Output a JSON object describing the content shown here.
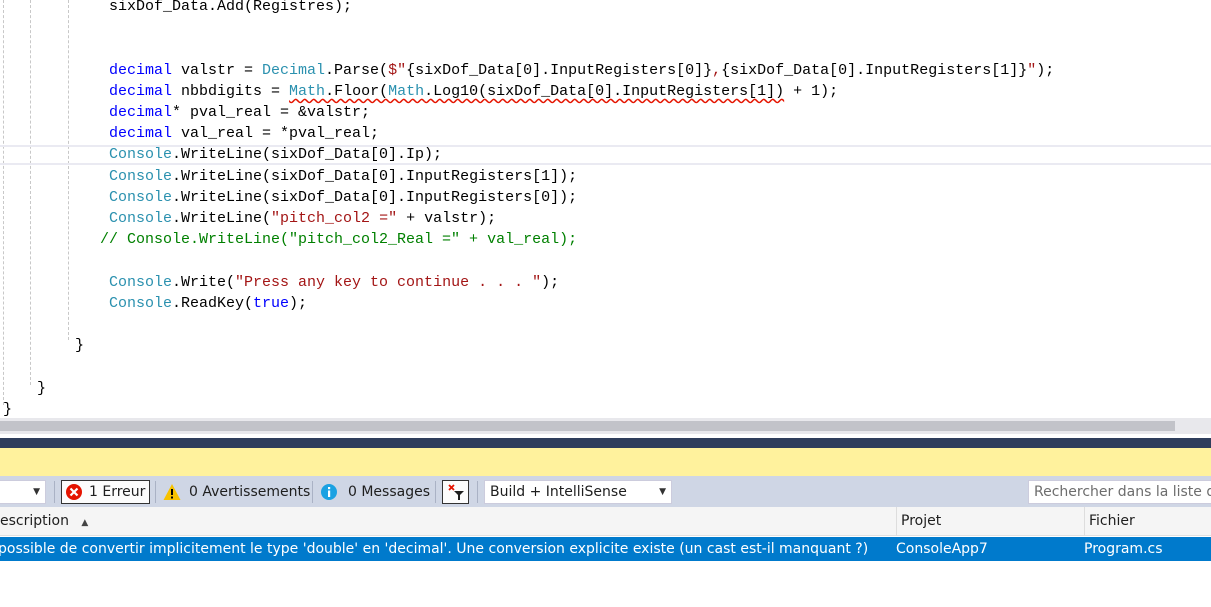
{
  "editor": {
    "lines": [
      {
        "indent": 109,
        "tokens": [
          [
            "sixDof_Data.Add(Registres);",
            ""
          ]
        ]
      },
      {
        "indent": 0,
        "tokens": []
      },
      {
        "indent": 0,
        "tokens": []
      },
      {
        "indent": 109,
        "tokens": [
          [
            "decimal",
            "kw"
          ],
          [
            " valstr = ",
            ""
          ],
          [
            "Decimal",
            "type"
          ],
          [
            ".Parse(",
            ""
          ],
          [
            "$\"",
            "str"
          ],
          [
            "{sixDof_Data[0].InputRegisters[0]}",
            ""
          ],
          [
            ",",
            "str"
          ],
          [
            "{sixDof_Data[0].InputRegisters[1]}",
            ""
          ],
          [
            "\"",
            "str"
          ],
          [
            ");",
            ""
          ]
        ]
      },
      {
        "indent": 109,
        "tokens": [
          [
            "decimal",
            "kw"
          ],
          [
            " nbbdigits = ",
            ""
          ],
          [
            "Math",
            "type err"
          ],
          [
            ".Floor(",
            "err"
          ],
          [
            "Math",
            "type err"
          ],
          [
            ".Log10(sixDof_Data[0].InputRegisters[1])",
            "err"
          ],
          [
            " + 1);",
            ""
          ]
        ]
      },
      {
        "indent": 109,
        "tokens": [
          [
            "decimal",
            "kw"
          ],
          [
            "* pval_real = &valstr;",
            ""
          ]
        ]
      },
      {
        "indent": 109,
        "tokens": [
          [
            "decimal",
            "kw"
          ],
          [
            " val_real = *pval_real;",
            ""
          ]
        ]
      },
      {
        "indent": 109,
        "tokens": [
          [
            "Console",
            "type"
          ],
          [
            ".WriteLine(sixDof_Data[0].Ip);",
            ""
          ]
        ]
      },
      {
        "indent": 109,
        "tokens": [
          [
            "Console",
            "type"
          ],
          [
            ".WriteLine(sixDof_Data[0].InputRegisters[1]);",
            ""
          ]
        ]
      },
      {
        "indent": 109,
        "tokens": [
          [
            "Console",
            "type"
          ],
          [
            ".WriteLine(sixDof_Data[0].InputRegisters[0]);",
            ""
          ]
        ]
      },
      {
        "indent": 109,
        "tokens": [
          [
            "Console",
            "type"
          ],
          [
            ".WriteLine(",
            ""
          ],
          [
            "\"pitch_col2 =\"",
            "str"
          ],
          [
            " + valstr);",
            ""
          ]
        ]
      },
      {
        "indent": 100,
        "tokens": [
          [
            "// Console.WriteLine(\"pitch_col2_Real =\" + val_real);",
            "cm"
          ]
        ]
      },
      {
        "indent": 0,
        "tokens": []
      },
      {
        "indent": 109,
        "tokens": [
          [
            "Console",
            "type"
          ],
          [
            ".Write(",
            ""
          ],
          [
            "\"Press any key to continue . . . \"",
            "str"
          ],
          [
            ");",
            ""
          ]
        ]
      },
      {
        "indent": 109,
        "tokens": [
          [
            "Console",
            "type"
          ],
          [
            ".ReadKey(",
            ""
          ],
          [
            "true",
            "kw"
          ],
          [
            ");",
            ""
          ]
        ]
      },
      {
        "indent": 0,
        "tokens": []
      },
      {
        "indent": 75,
        "tokens": [
          [
            "}",
            ""
          ]
        ]
      },
      {
        "indent": 0,
        "tokens": []
      },
      {
        "indent": 37,
        "tokens": [
          [
            "}",
            ""
          ]
        ]
      },
      {
        "indent": 3,
        "tokens": [
          [
            "}",
            ""
          ]
        ]
      }
    ]
  },
  "error_list": {
    "errors_label": "1 Erreur",
    "warnings_label": "0 Avertissements",
    "messages_label": "0 Messages",
    "build_filter": "Build + IntelliSense",
    "search_placeholder": "Rechercher dans la liste des erreurs",
    "columns": {
      "description": "escription",
      "project": "Projet",
      "file": "Fichier"
    },
    "rows": [
      {
        "description": "possible de convertir implicitement le type 'double' en 'decimal'. Une conversion explicite existe (un cast est-il manquant ?)",
        "project": "ConsoleApp7",
        "file": "Program.cs"
      }
    ]
  },
  "colors": {
    "keyword": "#0000ff",
    "type": "#2b91af",
    "string": "#a31515",
    "comment": "#008000",
    "selection": "#007acc",
    "info_bar": "#fff29d"
  }
}
